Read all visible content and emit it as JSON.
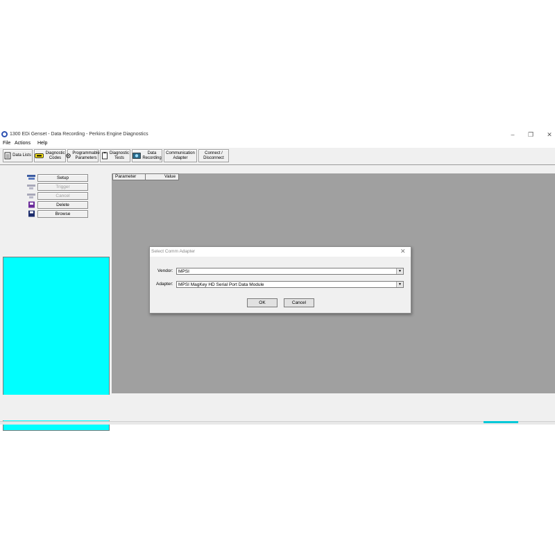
{
  "window": {
    "title": "1300 EDi Genset - Data Recording - Perkins Engine Diagnostics",
    "controls": {
      "minimize": "–",
      "restore": "❐",
      "close": "✕"
    }
  },
  "menu": [
    "File",
    "Actions",
    "Help"
  ],
  "toolbar": [
    {
      "label": "Data Lists",
      "icon": "data-lists-icon"
    },
    {
      "label": "Diagnostic\nCodes",
      "icon": "diagnostic-codes-icon"
    },
    {
      "label": "Programmable\nParameters",
      "icon": "programmable-parameters-icon"
    },
    {
      "label": "Diagnostic\nTests",
      "icon": "diagnostic-tests-icon"
    },
    {
      "label": "Data\nRecording",
      "icon": "data-recording-icon"
    },
    {
      "label": "Communication\nAdapter",
      "icon": ""
    },
    {
      "label": "Connect /\nDisconnect",
      "icon": ""
    }
  ],
  "left_panel": {
    "buttons": [
      {
        "label": "Setup",
        "enabled": true
      },
      {
        "label": "Trigger",
        "enabled": false
      },
      {
        "label": "Cancel",
        "enabled": false
      },
      {
        "label": "Delete",
        "enabled": true
      },
      {
        "label": "Browse",
        "enabled": true
      }
    ]
  },
  "grid": {
    "columns": [
      "Parameter",
      "Value"
    ]
  },
  "dialog": {
    "title": "Select Comm Adapter",
    "close": "✕",
    "vendor_label": "Vendor:",
    "vendor_value": "MPSI",
    "adapter_label": "Adapter:",
    "adapter_value": "MPSI MagKey HD Serial Port Data Module",
    "ok": "OK",
    "cancel": "Cancel"
  },
  "colors": {
    "panel": "#f0f0f0",
    "cyan": "#00ffff",
    "grey_area": "#a0a0a0"
  }
}
